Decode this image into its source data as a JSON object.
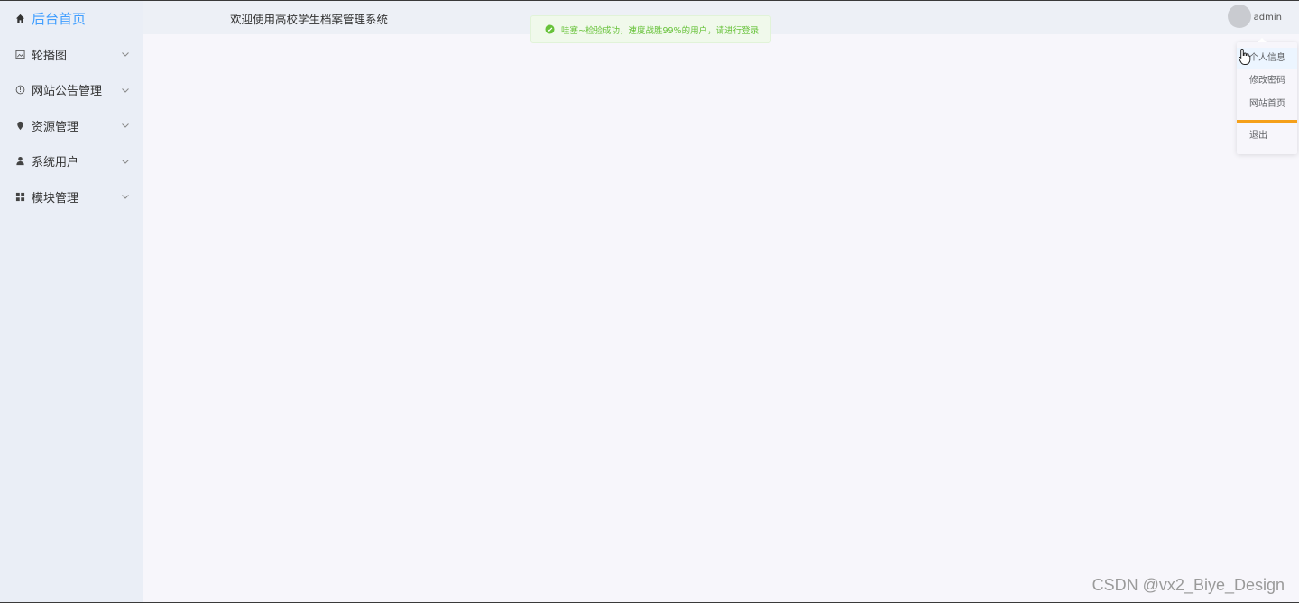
{
  "sidebar": {
    "items": [
      {
        "label": "后台首页",
        "icon": "home-icon",
        "active": true
      },
      {
        "label": "轮播图",
        "icon": "picture-icon"
      },
      {
        "label": "网站公告管理",
        "icon": "info-circle-icon"
      },
      {
        "label": "资源管理",
        "icon": "location-pin-icon"
      },
      {
        "label": "系统用户",
        "icon": "user-icon"
      },
      {
        "label": "模块管理",
        "icon": "grid-icon"
      }
    ]
  },
  "header": {
    "title": "欢迎使用高校学生档案管理系统",
    "username": "admin"
  },
  "toast": {
    "message": "哇塞~检验成功，速度战胜99%的用户，请进行登录",
    "type": "success"
  },
  "dropdown": {
    "items": [
      "个人信息",
      "修改密码",
      "网站首页",
      "退出"
    ]
  },
  "colors": {
    "accent": "#409eff",
    "success": "#67c23a",
    "divider": "#f5a01a",
    "sidebar_bg": "#eaeef6"
  },
  "watermark": "CSDN @vx2_Biye_Design"
}
